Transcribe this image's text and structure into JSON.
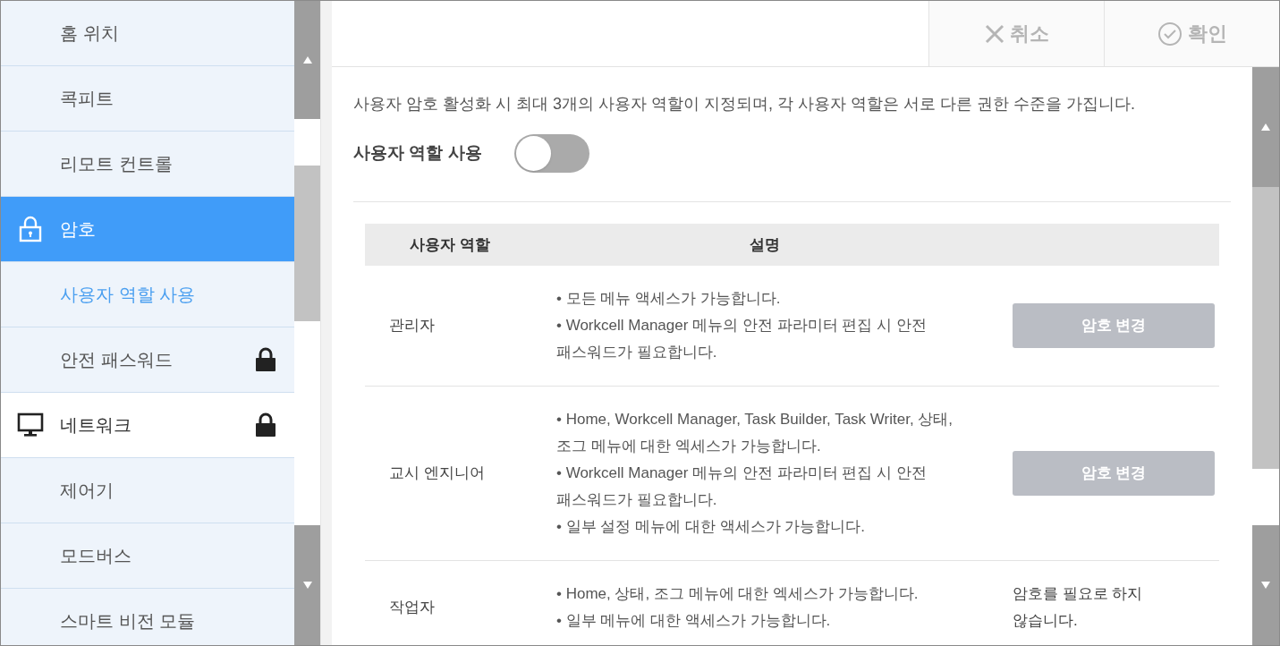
{
  "sidebar": {
    "items": [
      {
        "label": "홈 위치",
        "kind": "sub",
        "selected": false,
        "current": false,
        "locked": false
      },
      {
        "label": "콕피트",
        "kind": "sub",
        "selected": false,
        "current": false,
        "locked": false
      },
      {
        "label": "리모트 컨트롤",
        "kind": "sub",
        "selected": false,
        "current": false,
        "locked": false
      },
      {
        "label": "암호",
        "kind": "security",
        "selected": true,
        "current": false,
        "locked": false
      },
      {
        "label": "사용자 역할 사용",
        "kind": "sub",
        "selected": false,
        "current": true,
        "locked": false
      },
      {
        "label": "안전 패스워드",
        "kind": "sub",
        "selected": false,
        "current": false,
        "locked": true
      },
      {
        "label": "네트워크",
        "kind": "network",
        "selected": false,
        "current": false,
        "locked": true
      },
      {
        "label": "제어기",
        "kind": "sub",
        "selected": false,
        "current": false,
        "locked": false
      },
      {
        "label": "모드버스",
        "kind": "sub",
        "selected": false,
        "current": false,
        "locked": false
      },
      {
        "label": "스마트 비전 모듈",
        "kind": "sub",
        "selected": false,
        "current": false,
        "locked": false
      }
    ]
  },
  "header": {
    "buttons": [
      {
        "label": "취소",
        "kind": "cancel",
        "disabled": true
      },
      {
        "label": "확인",
        "kind": "confirm",
        "disabled": true
      }
    ]
  },
  "content": {
    "description": "사용자 암호 활성화 시 최대 3개의 사용자 역할이 지정되며, 각 사용자 역할은 서로 다른 권한 수준을 가집니다.",
    "toggle": {
      "label": "사용자 역할 사용",
      "on": false
    },
    "table": {
      "columns": [
        "사용자 역할",
        "설명"
      ],
      "rows": [
        {
          "role": "관리자",
          "bullets": [
            "• 모든 메뉴 액세스가 가능합니다.",
            "• Workcell Manager 메뉴의 안전 파라미터 편집 시 안전 패스워드가 필요합니다."
          ],
          "action": {
            "kind": "button",
            "label": "암호 변경",
            "disabled": true
          }
        },
        {
          "role": "교시 엔지니어",
          "bullets": [
            "• Home, Workcell Manager, Task Builder, Task Writer, 상태, 조그 메뉴에 대한 엑세스가 가능합니다.",
            "• Workcell Manager 메뉴의 안전 파라미터 편집 시 안전 패스워드가 필요합니다.",
            "• 일부 설정 메뉴에 대한 액세스가 가능합니다."
          ],
          "action": {
            "kind": "button",
            "label": "암호 변경",
            "disabled": true
          }
        },
        {
          "role": "작업자",
          "bullets": [
            "• Home, 상태, 조그 메뉴에 대한 엑세스가 가능합니다.",
            "• 일부 메뉴에 대한 액세스가 가능합니다."
          ],
          "action": {
            "kind": "text",
            "label": "암호를 필요로 하지 않습니다."
          }
        }
      ]
    }
  }
}
